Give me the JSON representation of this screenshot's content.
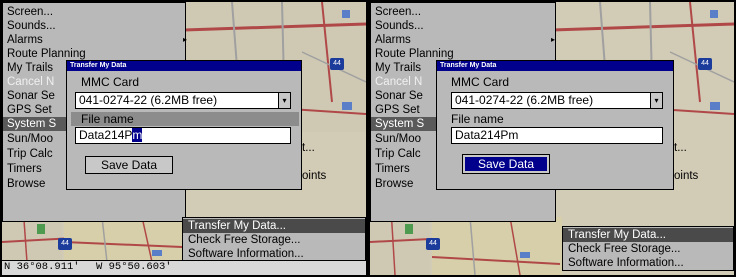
{
  "panels": [
    {
      "menu": {
        "items": [
          "Screen...",
          "Sounds...",
          "Alarms",
          "Route Planning",
          "My Trails",
          "Cancel N",
          "Sonar Se",
          "GPS Set",
          "System S",
          "Sun/Moo",
          "Trip Calc",
          "Timers",
          "Browse"
        ],
        "submenu_arrow": "▸"
      },
      "bottom_menu": {
        "items": [
          "Transfer My Data...",
          "Check Free Storage...",
          "Software Information..."
        ]
      },
      "fragments": [
        "t...",
        "oints"
      ],
      "dialog": {
        "title": "Transfer My Data",
        "card_label": "MMC Card",
        "card_value": "041-0274-22 (6.2MB free)",
        "dropdown_arrow": "▾",
        "file_label": "File name",
        "file_value_prefix": "Data214P",
        "file_value_cursor": "m",
        "save_label": "Save Data"
      },
      "status": {
        "lat": "N  36°08.911'",
        "lon": "W   95°50.603'"
      }
    },
    {
      "menu": {
        "items": [
          "Screen...",
          "Sounds...",
          "Alarms",
          "Route Planning",
          "My Trails",
          "Cancel N",
          "Sonar Se",
          "GPS Set",
          "System S",
          "Sun/Moo",
          "Trip Calc",
          "Timers",
          "Browse"
        ],
        "submenu_arrow": "▸"
      },
      "bottom_menu": {
        "items": [
          "Transfer My Data...",
          "Check Free Storage...",
          "Software Information..."
        ]
      },
      "fragments": [
        "t...",
        "oints"
      ],
      "dialog": {
        "title": "Transfer My Data",
        "card_label": "MMC Card",
        "card_value": "041-0274-22 (6.2MB free)",
        "dropdown_arrow": "▾",
        "file_label": "File name",
        "file_value": "Data214Pm",
        "save_label": "Save Data"
      }
    }
  ],
  "map_markers": [
    "44",
    "44",
    "44"
  ],
  "colors": {
    "titlebar": "#00008c",
    "menu_bg": "#b9b9b9",
    "highlight": "#4a4a4a",
    "map_bg": "#d2cbb6",
    "road": "#b04848",
    "water": "#5a7fc8",
    "park": "#4e9a4e"
  }
}
